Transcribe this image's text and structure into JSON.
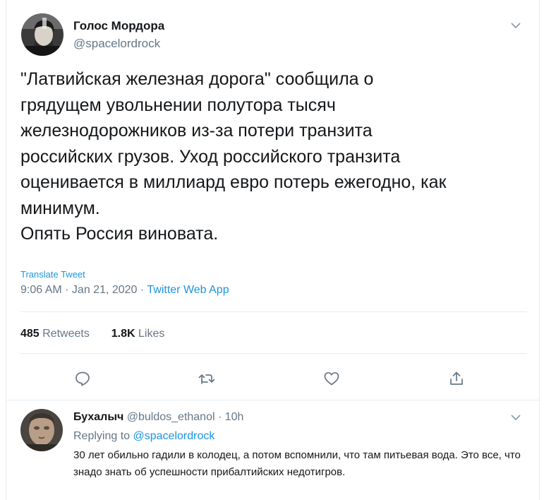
{
  "tweet": {
    "author": {
      "display_name": "Голос Мордора",
      "handle": "@spacelordrock"
    },
    "text": "\"Латвийская железная дорога\" сообщила о\nгрядущем увольнении полутора тысяч\nжелезнодорожников из-за потери транзита\nроссийских грузов. Уход российского транзита\nоценивается в миллиард евро потерь ежегодно, как\nминимум.\nОпять Россия виновата.",
    "translate_label": "Translate Tweet",
    "time": "9:06 AM",
    "date": "Jan 21, 2020",
    "separator": " · ",
    "source_app": "Twitter Web App",
    "stats": {
      "retweets_count": "485",
      "retweets_label": "Retweets",
      "likes_count": "1.8K",
      "likes_label": "Likes"
    },
    "actions": [
      "reply-icon",
      "retweet-icon",
      "like-icon",
      "share-icon"
    ]
  },
  "reply": {
    "author": {
      "display_name": "Бухалыч",
      "handle": "@buldos_ethanol",
      "separator": " · ",
      "time": "10h"
    },
    "replying_prefix": "Replying to ",
    "replying_to": "@spacelordrock",
    "text": "30 лет обильно гадили в колодец, а потом вспомнили, что там питьевая вода. Это все, что знадо знать об успешности прибалтийских недотигров."
  },
  "colors": {
    "text": "#14171a",
    "secondary": "#657786",
    "link": "#1b95e0",
    "divider": "#e6ecf0"
  }
}
